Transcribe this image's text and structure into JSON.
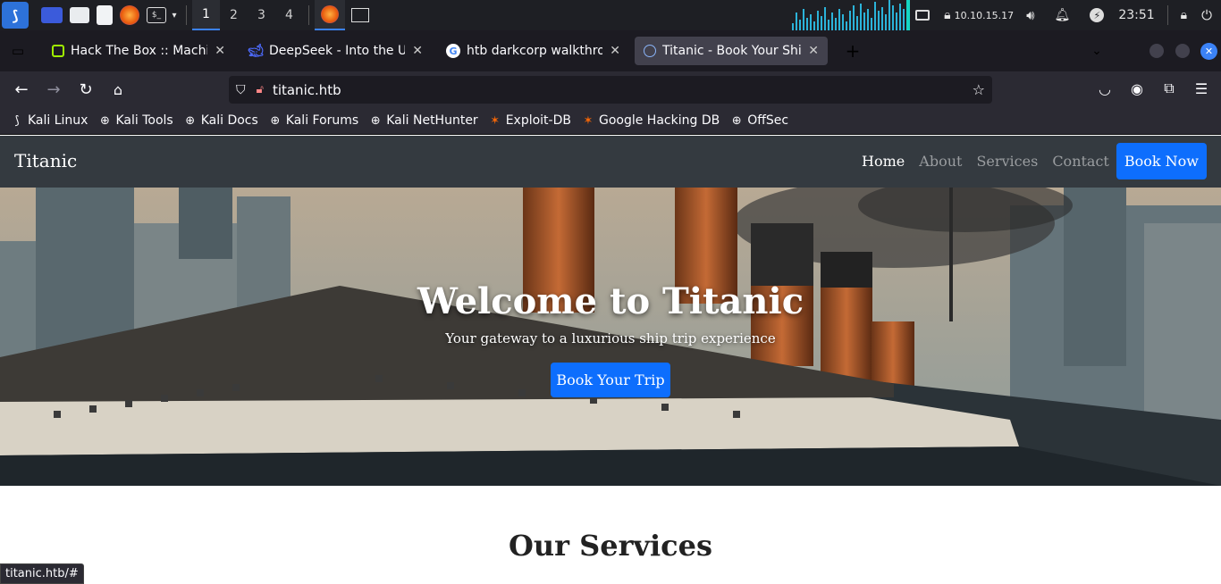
{
  "taskbar": {
    "workspaces": [
      "1",
      "2",
      "3",
      "4"
    ],
    "ip": "10.10.15.17",
    "time": "23:51",
    "icons": [
      "kali-menu-icon",
      "desktop-icon",
      "files-icon",
      "text-editor-icon",
      "firefox-icon",
      "terminal-icon"
    ]
  },
  "browser": {
    "tabs": [
      {
        "title": "Hack The Box :: Machines",
        "favicon": "htb-icon",
        "color": "#9fef00"
      },
      {
        "title": "DeepSeek - Into the Unkn",
        "favicon": "deepseek-icon",
        "color": "#4d6bfe"
      },
      {
        "title": "htb darkcorp walkthrough",
        "favicon": "google-icon",
        "color": "#4285f4"
      },
      {
        "title": "Titanic - Book Your Ship T",
        "favicon": "globe-icon",
        "color": "#8ab4f8"
      }
    ],
    "url": "titanic.htb",
    "bookmarks": [
      {
        "label": "Kali Linux",
        "icon": "kali-icon"
      },
      {
        "label": "Kali Tools",
        "icon": "globe-icon"
      },
      {
        "label": "Kali Docs",
        "icon": "globe-icon"
      },
      {
        "label": "Kali Forums",
        "icon": "globe-icon"
      },
      {
        "label": "Kali NetHunter",
        "icon": "globe-icon"
      },
      {
        "label": "Exploit-DB",
        "icon": "exploitdb-icon"
      },
      {
        "label": "Google Hacking DB",
        "icon": "exploitdb-icon"
      },
      {
        "label": "OffSec",
        "icon": "globe-icon"
      }
    ],
    "status_url": "titanic.htb/#"
  },
  "site": {
    "brand": "Titanic",
    "nav": [
      {
        "label": "Home",
        "active": true
      },
      {
        "label": "About",
        "active": false
      },
      {
        "label": "Services",
        "active": false
      },
      {
        "label": "Contact",
        "active": false
      }
    ],
    "book_now": "Book Now",
    "hero": {
      "title": "Welcome to Titanic",
      "subtitle": "Your gateway to a luxurious ship trip experience",
      "button": "Book Your Trip"
    },
    "services_title": "Our Services",
    "colors": {
      "primary": "#0d6efd",
      "navbar": "#343a40"
    }
  }
}
